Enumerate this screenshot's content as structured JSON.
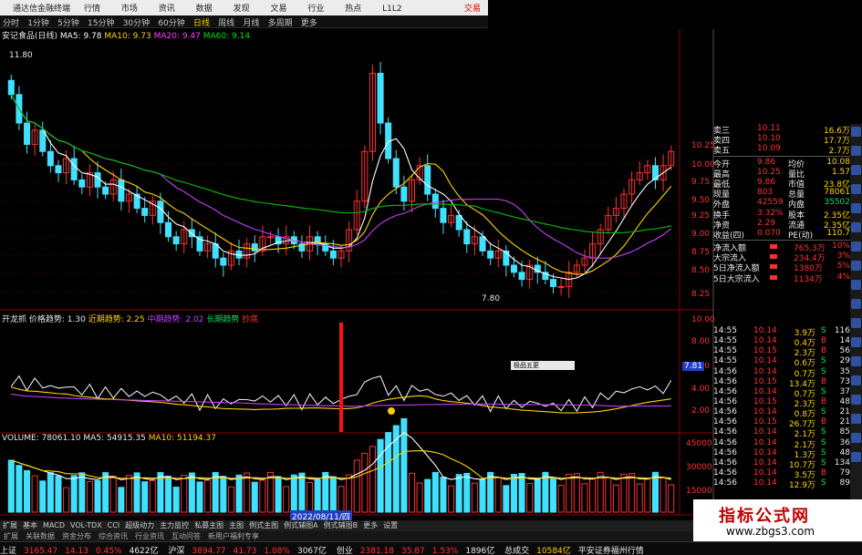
{
  "window": {
    "title": "通达信金融终端",
    "menu": [
      "行情",
      "市场",
      "资讯",
      "数据",
      "发现",
      "文易",
      "行业",
      "热点",
      "L1L2"
    ],
    "trade_label": "交易"
  },
  "toolbar": [
    "分时",
    "1分钟",
    "5分钟",
    "15分钟",
    "30分钟",
    "60分钟",
    "日线",
    "周线",
    "月线",
    "多周期",
    "更多"
  ],
  "toolbar_active": 6,
  "stock": {
    "name": "安记食品(日线)",
    "ma5": "MA5: 9.78",
    "ma10": "MA10: 9.73",
    "ma20": "MA20: 9.47",
    "ma60": "MA60: 9.14"
  },
  "price_peak": "11.80",
  "price_low": "7.80",
  "price_axis": [
    "10.25",
    "10.00",
    "9.75",
    "9.50",
    "9.25",
    "9.00",
    "8.75",
    "8.50",
    "8.25"
  ],
  "indicator": {
    "name": "开龙抓",
    "p1": "价格趋势: 1.30",
    "p2": "近期趋势: 2.25",
    "p3": "中期趋势: 2.02",
    "p4": "长期趋势",
    "p5": "抄底"
  },
  "indicator_axis": [
    "10.00",
    "8.00",
    "6.00",
    "4.00",
    "2.00"
  ],
  "indicator_val": "7.81",
  "volume": {
    "label": "VOLUME: 78061.10",
    "ma5": "MA5: 54915.35",
    "ma10": "MA10: 51194.37"
  },
  "volume_axis": [
    "45000",
    "30000",
    "15000"
  ],
  "date_label": "2022/08/11/四",
  "popup": "极品五更",
  "quote": {
    "rows": [
      [
        "卖三",
        "10.11",
        "16.6万"
      ],
      [
        "卖四",
        "10.10",
        "17.7万"
      ],
      [
        "卖五",
        "10.09",
        "2.7万"
      ]
    ],
    "stats": [
      [
        "今开",
        "9.86",
        "均价",
        "10.08"
      ],
      [
        "最高",
        "10.25",
        "量比",
        "1.57"
      ],
      [
        "最低",
        "9.86",
        "市值",
        "23.8亿"
      ],
      [
        "现量",
        "803",
        "总量",
        "78061"
      ],
      [
        "外盘",
        "42559",
        "内盘",
        "35502"
      ],
      [
        "换手",
        "3.32%",
        "股本",
        "2.35亿"
      ],
      [
        "净资",
        "2.29",
        "流通",
        "2.35亿"
      ],
      [
        "收益(四)",
        "0.070",
        "PE(动)",
        "110.7"
      ]
    ],
    "flow": [
      [
        "净流入额",
        "765.3万",
        "10%"
      ],
      [
        "大宗流入",
        "234.4万",
        "3%"
      ],
      [
        "5日净流入额",
        "1380万",
        "5%"
      ],
      [
        "5日大宗流入",
        "1134万",
        "4%"
      ]
    ]
  },
  "ticks": [
    [
      "14:55",
      "10.14",
      "3.9万",
      "S",
      "116"
    ],
    [
      "14:55",
      "10.14",
      "0.4万",
      "B",
      "14"
    ],
    [
      "14:55",
      "10.15",
      "2.3万",
      "B",
      "56"
    ],
    [
      "14:55",
      "10.14",
      "0.6万",
      "S",
      "29"
    ],
    [
      "14:56",
      "10.14",
      "0.7万",
      "S",
      "35"
    ],
    [
      "14:56",
      "10.15",
      "13.4万",
      "B",
      "73"
    ],
    [
      "14:56",
      "10.14",
      "0.7万",
      "S",
      "37"
    ],
    [
      "14:56",
      "10.15",
      "2.3万",
      "B",
      "48"
    ],
    [
      "14:56",
      "10.14",
      "0.8万",
      "S",
      "21"
    ],
    [
      "14:56",
      "10.15",
      "26.7万",
      "B",
      "21"
    ],
    [
      "14:56",
      "10.14",
      "2.1万",
      "S",
      "85"
    ],
    [
      "14:56",
      "10.14",
      "2.1万",
      "S",
      "36"
    ],
    [
      "14:56",
      "10.14",
      "1.3万",
      "S",
      "48"
    ],
    [
      "14:56",
      "10.14",
      "10.7万",
      "S",
      "134"
    ],
    [
      "14:56",
      "10.14",
      "3.5万",
      "B",
      "79"
    ],
    [
      "14:56",
      "10.14",
      "12.9万",
      "S",
      "89"
    ]
  ],
  "tabs1": [
    "扩展",
    "基本",
    "MACD",
    "VOL-TDX",
    "CCI",
    "超级动力",
    "主力监控",
    "私募主图",
    "主图",
    "例式主图",
    "例式辅图A",
    "例式辅图B",
    "更多",
    "设置"
  ],
  "tabs2": [
    "扩展",
    "关联数据",
    "资金分布",
    "综合资讯",
    "行业资讯",
    "互动问答",
    "新用户福利专享"
  ],
  "status": {
    "sh_label": "上证",
    "sh_val": "3165.47",
    "sh_chg": "14.13",
    "sh_pct": "0.45%",
    "sh_amt": "4622亿",
    "sz_label": "沪深",
    "sz_val": "3894.77",
    "sz_chg": "41.73",
    "sz_pct": "1.08%",
    "sz_amt": "3067亿",
    "cy_label": "创业",
    "cy_val": "2381.18",
    "cy_chg": "35.87",
    "cy_pct": "1.53%",
    "cy_amt": "1896亿",
    "total_label": "总成交",
    "total_val": "10584亿",
    "broker": "平安证券福州行情"
  },
  "watermark": {
    "line1": "指标公式网",
    "line2": "www.zbgs3.com"
  }
}
